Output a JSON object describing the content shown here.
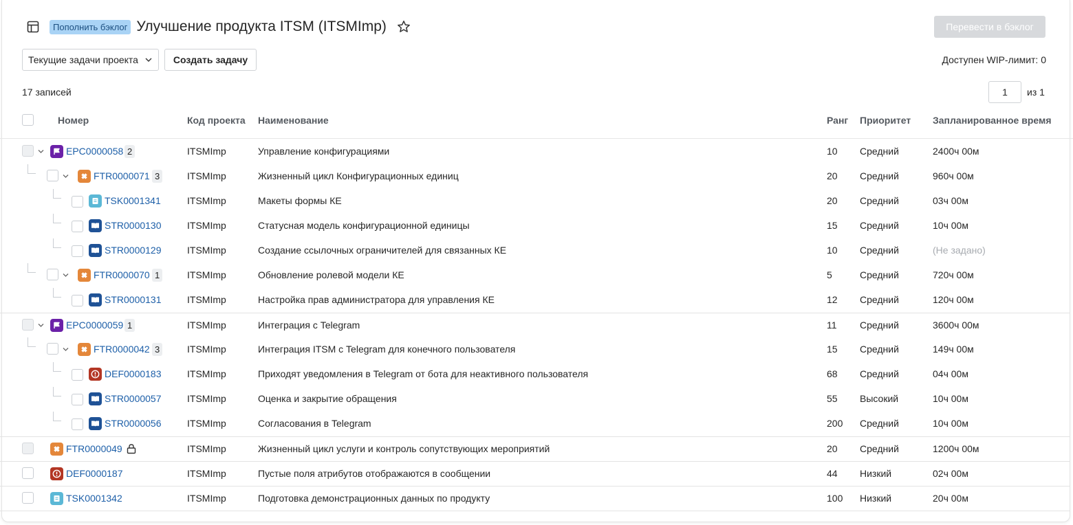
{
  "header": {
    "backlog_tag": "Пополнить бэклог",
    "project_title": "Улучшение продукта ITSM (ITSMImp)",
    "move_button": "Перевести в бэклог"
  },
  "toolbar": {
    "filter_value": "Текущие задачи проекта",
    "create_button": "Создать задачу",
    "wip_limit": "Доступен WIP-лимит: 0"
  },
  "summary": {
    "records": "17 записей",
    "page": "1",
    "of_pages": "из 1"
  },
  "columns": {
    "number": "Номер",
    "project_code": "Код проекта",
    "name": "Наименование",
    "rank": "Ранг",
    "priority": "Приоритет",
    "planned_time": "Запланированное время"
  },
  "colors": {
    "epic": "#6b21a8",
    "feature": "#e4873a",
    "task": "#5bb8d6",
    "story": "#1f5296",
    "defect": "#b33624",
    "link": "#1d5fa8",
    "backlog_tag_bg": "#a9d3f5"
  },
  "rows": [
    {
      "number": "EPC0000058",
      "type": "epic",
      "badge": "2",
      "code": "ITSMImp",
      "name": "Управление конфигурациями",
      "rank": "10",
      "priority": "Средний",
      "time": "2400ч 00м"
    },
    {
      "number": "FTR0000071",
      "type": "feature",
      "badge": "3",
      "code": "ITSMImp",
      "name": "Жизненный цикл Конфигурационных единиц",
      "rank": "20",
      "priority": "Средний",
      "time": "960ч 00м"
    },
    {
      "number": "TSK0001341",
      "type": "task",
      "badge": "",
      "code": "ITSMImp",
      "name": "Макеты формы КЕ",
      "rank": "20",
      "priority": "Средний",
      "time": "03ч 00м"
    },
    {
      "number": "STR0000130",
      "type": "story",
      "badge": "",
      "code": "ITSMImp",
      "name": "Статусная модель конфигурационной единицы",
      "rank": "15",
      "priority": "Средний",
      "time": "10ч 00м"
    },
    {
      "number": "STR0000129",
      "type": "story",
      "badge": "",
      "code": "ITSMImp",
      "name": "Создание ссылочных ограничителей для связанных КЕ",
      "rank": "10",
      "priority": "Средний",
      "time": "(Не задано)"
    },
    {
      "number": "FTR0000070",
      "type": "feature",
      "badge": "1",
      "code": "ITSMImp",
      "name": "Обновление ролевой модели КЕ",
      "rank": "5",
      "priority": "Средний",
      "time": "720ч 00м"
    },
    {
      "number": "STR0000131",
      "type": "story",
      "badge": "",
      "code": "ITSMImp",
      "name": "Настройка прав администратора для управления КЕ",
      "rank": "12",
      "priority": "Средний",
      "time": "120ч 00м"
    },
    {
      "number": "EPC0000059",
      "type": "epic",
      "badge": "1",
      "code": "ITSMImp",
      "name": "Интеграция с Telegram",
      "rank": "11",
      "priority": "Средний",
      "time": "3600ч 00м"
    },
    {
      "number": "FTR0000042",
      "type": "feature",
      "badge": "3",
      "code": "ITSMImp",
      "name": "Интеграция ITSM с Telegram для конечного пользователя",
      "rank": "15",
      "priority": "Средний",
      "time": "149ч 00м"
    },
    {
      "number": "DEF0000183",
      "type": "defect",
      "badge": "",
      "code": "ITSMImp",
      "name": "Приходят уведомления в Telegram от бота для неактивного пользователя",
      "rank": "68",
      "priority": "Средний",
      "time": "04ч 00м"
    },
    {
      "number": "STR0000057",
      "type": "story",
      "badge": "",
      "code": "ITSMImp",
      "name": "Оценка и закрытие обращения",
      "rank": "55",
      "priority": "Высокий",
      "time": "10ч 00м"
    },
    {
      "number": "STR0000056",
      "type": "story",
      "badge": "",
      "code": "ITSMImp",
      "name": "Согласования в Telegram",
      "rank": "200",
      "priority": "Средний",
      "time": "10ч 00м"
    },
    {
      "number": "FTR0000049",
      "type": "feature",
      "badge": "",
      "code": "ITSMImp",
      "name": "Жизненный цикл услуги и контроль сопутствующих мероприятий",
      "rank": "20",
      "priority": "Средний",
      "time": "1200ч 00м"
    },
    {
      "number": "DEF0000187",
      "type": "defect",
      "badge": "",
      "code": "ITSMImp",
      "name": "Пустые поля атрибутов отображаются в сообщении",
      "rank": "44",
      "priority": "Низкий",
      "time": "02ч 00м"
    },
    {
      "number": "TSK0001342",
      "type": "task",
      "badge": "",
      "code": "ITSMImp",
      "name": "Подготовка демонстрационных данных по продукту",
      "rank": "100",
      "priority": "Низкий",
      "time": "20ч 00м"
    }
  ]
}
